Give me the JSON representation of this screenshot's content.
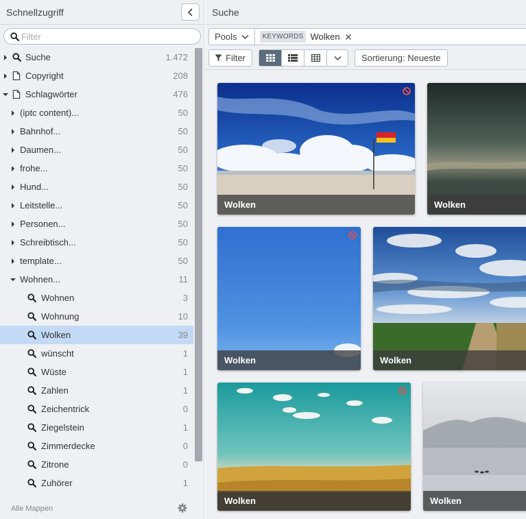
{
  "left_panel": {
    "title": "Schnellzugriff",
    "filter_placeholder": "Filter",
    "footer_label": "Alle Mappen"
  },
  "tree": {
    "top": [
      {
        "label": "Suche",
        "count": "1.472"
      },
      {
        "label": "Copyright",
        "count": "208"
      },
      {
        "label": "Schlagwörter",
        "count": "476"
      }
    ],
    "groups": [
      {
        "label": "(iptc content)...",
        "count": "50"
      },
      {
        "label": "Bahnhof...",
        "count": "50"
      },
      {
        "label": "Daumen...",
        "count": "50"
      },
      {
        "label": "frohe...",
        "count": "50"
      },
      {
        "label": "Hund...",
        "count": "50"
      },
      {
        "label": "Leitstelle...",
        "count": "50"
      },
      {
        "label": "Personen...",
        "count": "50"
      },
      {
        "label": "Schreibtisch...",
        "count": "50"
      },
      {
        "label": "template...",
        "count": "50"
      },
      {
        "label": "Wohnen...",
        "count": "11"
      }
    ],
    "keywords": [
      {
        "label": "Wohnen",
        "count": "3"
      },
      {
        "label": "Wohnung",
        "count": "10"
      },
      {
        "label": "Wolken",
        "count": "39"
      },
      {
        "label": "wünscht",
        "count": "1"
      },
      {
        "label": "Wüste",
        "count": "1"
      },
      {
        "label": "Zahlen",
        "count": "1"
      },
      {
        "label": "Zeichentrick",
        "count": "0"
      },
      {
        "label": "Ziegelstein",
        "count": "1"
      },
      {
        "label": "Zimmerdecke",
        "count": "0"
      },
      {
        "label": "Zitrone",
        "count": "0"
      },
      {
        "label": "Zuhörer",
        "count": "1"
      }
    ],
    "selected_keyword": "Wolken"
  },
  "right_panel": {
    "title": "Suche",
    "pools_label": "Pools",
    "tag_key": "KEYWORDS",
    "tag_value": "Wolken",
    "filter_button": "Filter",
    "sort_button": "Sortierung: Neueste",
    "active_view": "grid-large"
  },
  "results": [
    {
      "caption": "Wolken",
      "blocked": true,
      "scene": "beach-flag"
    },
    {
      "caption": "Wolken",
      "blocked": false,
      "scene": "dark-sea"
    },
    {
      "caption": "Wolken",
      "blocked": true,
      "scene": "blue-sky"
    },
    {
      "caption": "Wolken",
      "blocked": false,
      "scene": "field-road"
    },
    {
      "caption": "Wolken",
      "blocked": true,
      "scene": "teal-grass"
    },
    {
      "caption": "Wolken",
      "blocked": false,
      "scene": "misty-lake"
    }
  ],
  "colors": {
    "selection": "#c3daf7",
    "active_view_button": "#5b6d7f",
    "caption_bar": "rgba(60,60,60,0.78)",
    "blocked_icon": "#d9534f"
  }
}
